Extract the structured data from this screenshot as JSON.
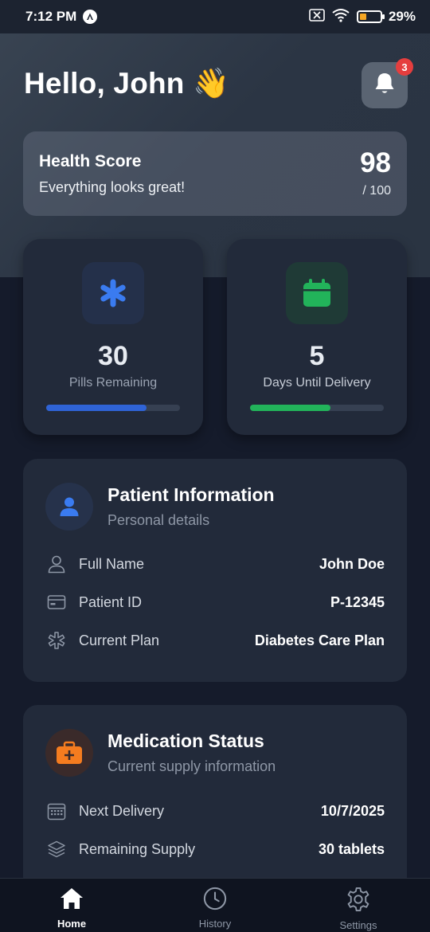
{
  "status_bar": {
    "time": "7:12 PM",
    "battery": "29%"
  },
  "header": {
    "greeting": "Hello, John",
    "wave_emoji": "👋",
    "notification_count": "3"
  },
  "health_score": {
    "title": "Health Score",
    "subtitle": "Everything looks great!",
    "value": "98",
    "max": "/ 100"
  },
  "stats": [
    {
      "value": "30",
      "label": "Pills Remaining",
      "progress": 0.75,
      "color": "#2f63d6",
      "icon": "asterisk-icon"
    },
    {
      "value": "5",
      "label": "Days Until Delivery",
      "progress": 0.6,
      "color": "#22b35a",
      "icon": "calendar-icon"
    }
  ],
  "patient_info": {
    "title": "Patient Information",
    "subtitle": "Personal details",
    "rows": [
      {
        "label": "Full Name",
        "value": "John Doe",
        "icon": "user-icon"
      },
      {
        "label": "Patient ID",
        "value": "P-12345",
        "icon": "card-icon"
      },
      {
        "label": "Current Plan",
        "value": "Diabetes Care Plan",
        "icon": "asterisk-outline-icon"
      }
    ]
  },
  "medication_status": {
    "title": "Medication Status",
    "subtitle": "Current supply information",
    "rows": [
      {
        "label": "Next Delivery",
        "value": "10/7/2025",
        "icon": "calendar-outline-icon"
      },
      {
        "label": "Remaining Supply",
        "value": "30 tablets",
        "icon": "layers-icon"
      }
    ]
  },
  "nav": [
    {
      "label": "Home",
      "active": true,
      "icon": "home-icon"
    },
    {
      "label": "History",
      "active": false,
      "icon": "clock-icon"
    },
    {
      "label": "Settings",
      "active": false,
      "icon": "gear-icon"
    }
  ],
  "colors": {
    "accent_blue": "#3a7bf0",
    "accent_green": "#22b35a",
    "accent_orange": "#f57c1f",
    "badge_red": "#e53e3e"
  }
}
